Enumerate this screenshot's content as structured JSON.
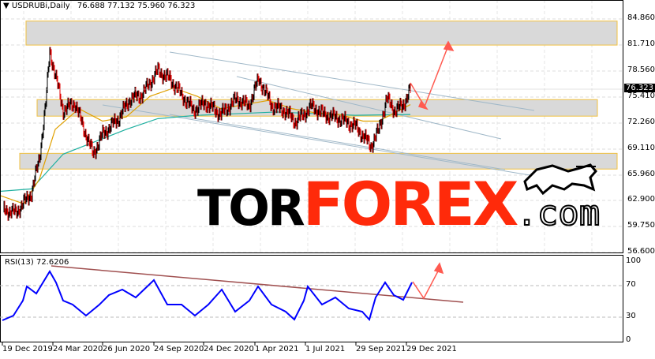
{
  "header": {
    "symbol": "USDRUBi,Daily",
    "ohlc": "76.688 77.132 75.960 76.323"
  },
  "current_price_label": "76.323",
  "rsi_label": "RSI(13) 72.6206",
  "logo": {
    "tor": "TOR",
    "forex": "FOREX",
    "com": ".com"
  },
  "colors": {
    "price": "#000000",
    "ma_fast": "#e0a000",
    "ma_slow": "#20b0a0",
    "rsi": "#0000ff",
    "arrow": "#ff5a50",
    "zone_fill": "#d9d9d9",
    "zone_border": "#f0c040",
    "trend": "#a0b8c8",
    "rsi_trend": "#a05050"
  },
  "chart_data": [
    {
      "type": "line",
      "title": "USDRUBi,Daily",
      "x_unit": "bar index",
      "yticks": [
        "84.860",
        "81.710",
        "78.560",
        "75.410",
        "72.260",
        "69.110",
        "65.960",
        "62.900",
        "59.750",
        "56.600"
      ],
      "ylim": [
        56.6,
        84.86
      ],
      "xtick_labels": [
        "19 Dec 2019",
        "24 Mar 2020",
        "26 Jun 2020",
        "24 Sep 2020",
        "24 Dec 2020",
        "1 Apr 2021",
        "1 Jul 2021",
        "29 Sep 2021",
        "29 Dec 2021"
      ],
      "price": {
        "x": [
          5,
          20,
          40,
          50,
          58,
          63,
          70,
          80,
          95,
          105,
          118,
          130,
          150,
          165,
          180,
          200,
          215,
          230,
          245,
          260,
          280,
          300,
          315,
          328,
          345,
          360,
          375,
          395,
          410,
          430,
          450,
          470,
          480,
          490,
          500,
          510,
          520
        ],
        "y": [
          61.8,
          61.4,
          63.8,
          68.1,
          74.7,
          81.0,
          78.1,
          73.8,
          74.7,
          71.9,
          68.5,
          70.9,
          72.8,
          75.2,
          75.7,
          78.6,
          77.6,
          75.7,
          73.8,
          74.7,
          73.3,
          75.2,
          74.3,
          77.6,
          74.3,
          73.8,
          72.4,
          74.3,
          73.3,
          72.8,
          71.9,
          69.5,
          71.4,
          75.2,
          73.8,
          74.3,
          76.3
        ]
      },
      "ma_fast": {
        "x": [
          0,
          30,
          50,
          70,
          100,
          130,
          160,
          190,
          220,
          250,
          280,
          310,
          340,
          370,
          400,
          430,
          460,
          480,
          500,
          520
        ],
        "y": [
          63.5,
          62.5,
          65.5,
          71.5,
          74.0,
          72.5,
          73.0,
          75.5,
          76.5,
          75.5,
          74.0,
          74.5,
          75.0,
          74.0,
          73.5,
          73.3,
          72.5,
          72.5,
          73.5,
          74.5
        ]
      },
      "ma_slow": {
        "x": [
          0,
          40,
          80,
          120,
          160,
          200,
          250,
          300,
          350,
          400,
          450,
          520
        ],
        "y": [
          64.0,
          64.3,
          68.5,
          70.0,
          71.5,
          72.8,
          73.2,
          73.4,
          73.6,
          73.4,
          73.2,
          73.3
        ]
      },
      "zones": [
        [
          81.7,
          84.6
        ],
        [
          73.1,
          75.1
        ],
        [
          66.7,
          68.6
        ]
      ]
    },
    {
      "type": "line",
      "title": "RSI(13) 72.6206",
      "yticks": [
        "100",
        "70",
        "30",
        "0"
      ],
      "ylim": [
        0,
        100
      ],
      "levels": [
        70,
        30
      ],
      "rsi": {
        "x": [
          3,
          17,
          29,
          34,
          46,
          63,
          71,
          80,
          92,
          109,
          126,
          138,
          155,
          172,
          195,
          212,
          230,
          247,
          264,
          281,
          298,
          316,
          327,
          344,
          362,
          373,
          385,
          390,
          408,
          425,
          442,
          459,
          468,
          476,
          488,
          499,
          511,
          522
        ],
        "y": [
          26,
          32,
          51,
          69,
          60,
          88,
          74,
          51,
          46,
          32,
          46,
          58,
          65,
          55,
          77,
          46,
          46,
          32,
          46,
          65,
          37,
          51,
          69,
          46,
          37,
          27,
          51,
          69,
          46,
          55,
          41,
          37,
          27,
          55,
          74,
          58,
          52,
          74
        ]
      }
    }
  ]
}
